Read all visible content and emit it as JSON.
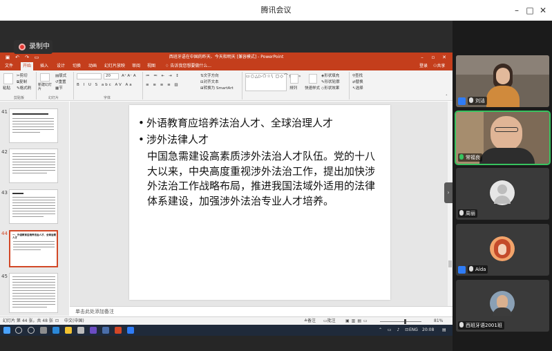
{
  "meeting": {
    "title": "腾讯会议",
    "recording_label": "录制中",
    "window_controls": {
      "minimize": "–",
      "maximize": "□",
      "close": "✕"
    }
  },
  "ppt": {
    "title": "西班牙语在中国的昨天、今天和明天 [兼容模式] - PowerPoint",
    "tabs": [
      "文件",
      "开始",
      "插入",
      "设计",
      "切换",
      "动画",
      "幻灯片放映",
      "审阅",
      "视图"
    ],
    "tell_me": "告诉我您想要做什么...",
    "signin": "登录",
    "share": "共享",
    "ribbon": {
      "paste": "粘贴",
      "cut": "剪切",
      "copy": "复制",
      "format_painter": "格式刷",
      "new_slide": "新建幻灯片",
      "layout": "版式",
      "reset": "重置",
      "section": "节",
      "font_size": "20",
      "text_direction": "文字方向",
      "align_text": "对齐文本",
      "smartart": "转换为 SmartArt",
      "arrange": "排列",
      "quick_styles": "快速样式",
      "shape_fill": "形状填充",
      "shape_outline": "形状轮廓",
      "shape_effects": "形状效果",
      "find": "查找",
      "replace": "替换",
      "select": "选择",
      "group_clipboard": "剪贴板",
      "group_slides": "幻灯片",
      "group_font": "字体"
    },
    "thumb_numbers": [
      "41",
      "42",
      "43",
      "44",
      "45"
    ],
    "thumb44_title": "一、外语教育应培养法治人才、全球治理人才",
    "slide": {
      "bullet1": "外语教育应培养法治人才、全球治理人才",
      "bullet2": "涉外法律人才",
      "paragraph": "中国急需建设高素质涉外法治人才队伍。党的十八大以来，中央高度重视涉外法治工作，提出加快涉外法治工作战略布局，推进我国法域外适用的法律体系建设，加强涉外法治专业人才培养。"
    },
    "notes_placeholder": "单击此处添加备注",
    "status": {
      "slide_count": "幻灯片 第 44 张，共 48 张",
      "language": "中文(中国)",
      "notes": "备注",
      "comments": "批注",
      "zoom": "81%"
    }
  },
  "taskbar": {
    "lang": "ENG",
    "time": "20:08"
  },
  "participants": [
    {
      "name": "刘洁",
      "mic_on": false,
      "host": true
    },
    {
      "name": "常福良",
      "mic_on": true,
      "host": false,
      "active": true
    },
    {
      "name": "周丽",
      "mic_on": false,
      "host": false
    },
    {
      "name": "Aída",
      "mic_on": false,
      "host": true
    },
    {
      "name": "西班牙语2001班",
      "mic_on": false,
      "host": false
    }
  ]
}
